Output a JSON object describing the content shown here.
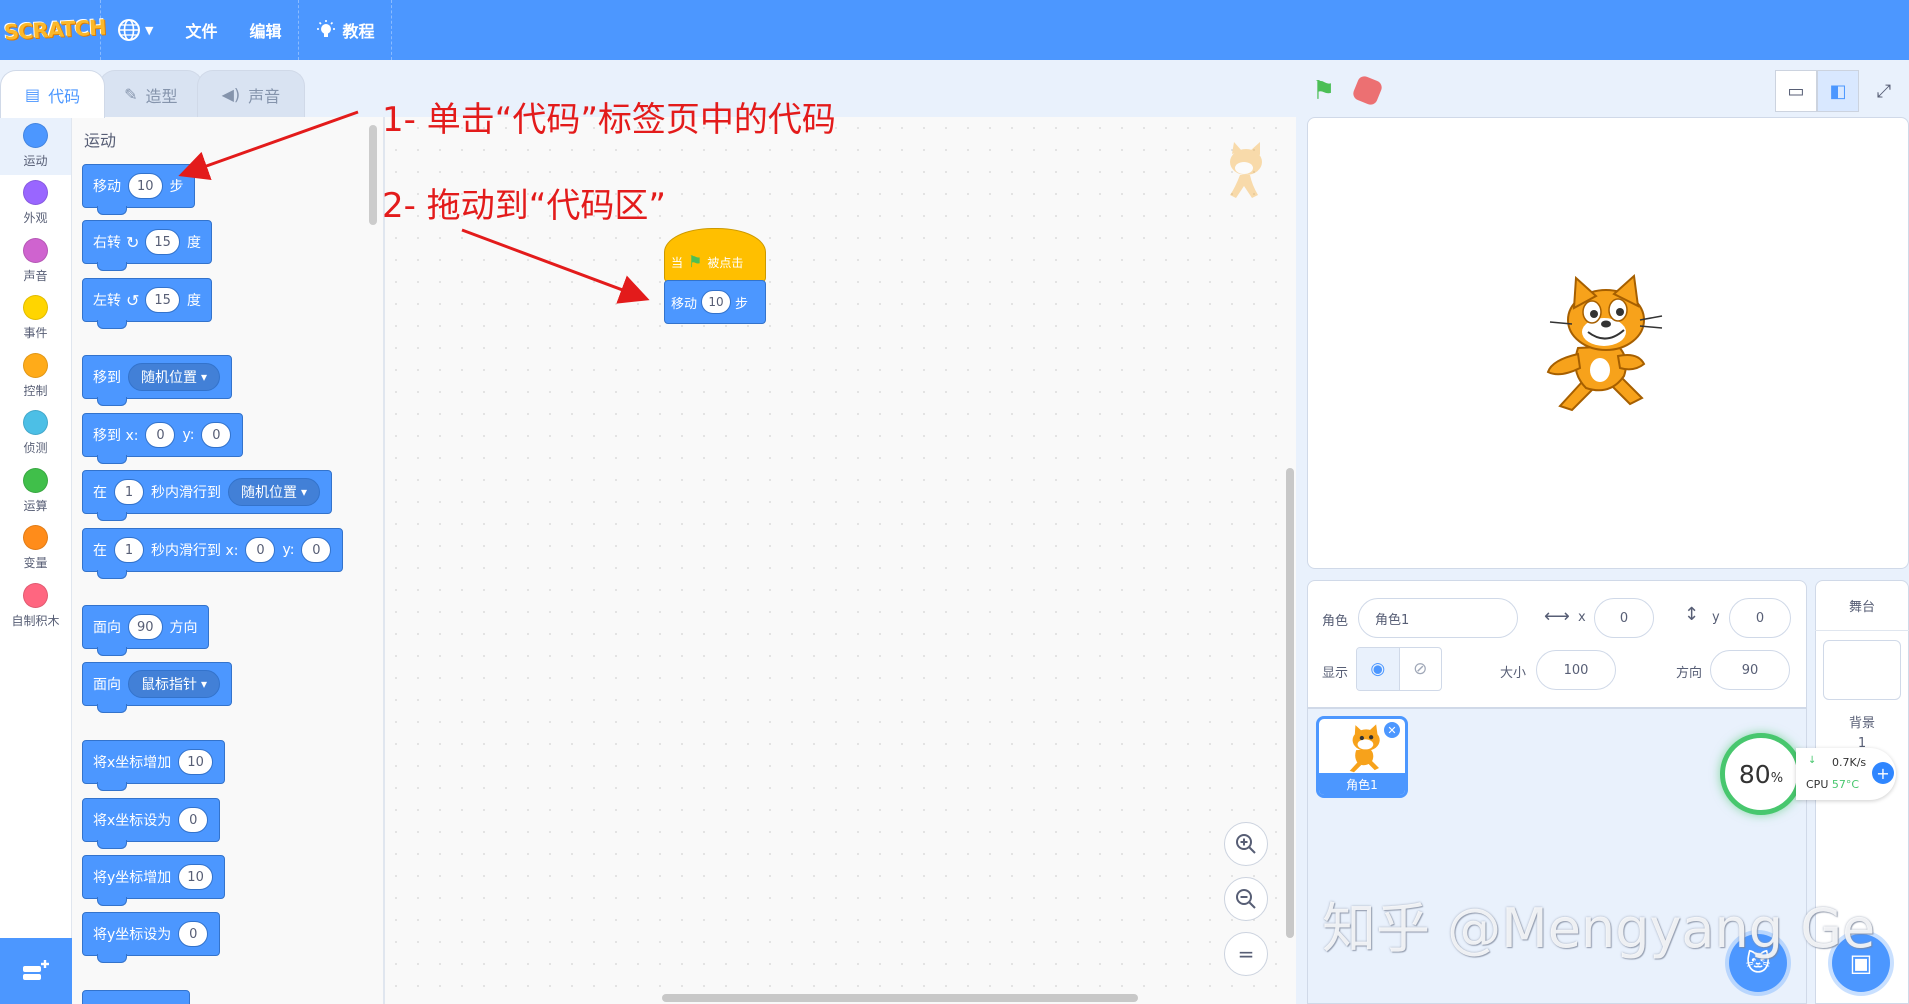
{
  "menu": {
    "logo": "SCRATCH",
    "language_icon": "globe-icon",
    "file": "文件",
    "edit": "编辑",
    "tutorials": "教程"
  },
  "tabs": [
    {
      "label": "代码",
      "icon": "code-icon",
      "active": true
    },
    {
      "label": "造型",
      "icon": "brush-icon",
      "active": false
    },
    {
      "label": "声音",
      "icon": "speaker-icon",
      "active": false
    }
  ],
  "categories": [
    {
      "label": "运动",
      "color": "#4c97ff"
    },
    {
      "label": "外观",
      "color": "#9966ff"
    },
    {
      "label": "声音",
      "color": "#cf63cf"
    },
    {
      "label": "事件",
      "color": "#ffd500"
    },
    {
      "label": "控制",
      "color": "#ffab19"
    },
    {
      "label": "侦测",
      "color": "#4cbfe6"
    },
    {
      "label": "运算",
      "color": "#40bf4a"
    },
    {
      "label": "变量",
      "color": "#ff8c1a"
    },
    {
      "label": "自制积木",
      "color": "#ff6680"
    }
  ],
  "palette": {
    "title": "运动",
    "blocks": {
      "move": {
        "label": "移动",
        "value": "10",
        "unit": "步"
      },
      "turn_right": {
        "label": "右转",
        "value": "15",
        "unit": "度"
      },
      "turn_left": {
        "label": "左转",
        "value": "15",
        "unit": "度"
      },
      "goto": {
        "label": "移到",
        "option": "随机位置"
      },
      "goto_xy": {
        "label": "移到 x:",
        "x": "0",
        "y_label": "y:",
        "y": "0"
      },
      "glide_to": {
        "label": "在",
        "secs": "1",
        "mid": "秒内滑行到",
        "option": "随机位置"
      },
      "glide_xy": {
        "label": "在",
        "secs": "1",
        "mid": "秒内滑行到 x:",
        "x": "0",
        "y_label": "y:",
        "y": "0"
      },
      "point_dir": {
        "label": "面向",
        "value": "90",
        "unit": "方向"
      },
      "point_towards": {
        "label": "面向",
        "option": "鼠标指针"
      },
      "change_x": {
        "label": "将x坐标增加",
        "value": "10"
      },
      "set_x": {
        "label": "将x坐标设为",
        "value": "0"
      },
      "change_y": {
        "label": "将y坐标增加",
        "value": "10"
      },
      "set_y": {
        "label": "将y坐标设为",
        "value": "0"
      }
    }
  },
  "code": {
    "hat": {
      "when": "当",
      "clicked": "被点击"
    },
    "move": {
      "label": "移动",
      "value": "10",
      "unit": "步"
    }
  },
  "annotations": {
    "step1": "1- 单击“代码”标签页中的代码",
    "step2": "2- 拖动到“代码区”"
  },
  "zoom": {
    "in": "+",
    "out": "−",
    "reset": "="
  },
  "sprite_info": {
    "sprite_label": "角色",
    "sprite_name": "角色1",
    "x_label": "x",
    "x": "0",
    "y_label": "y",
    "y": "0",
    "show_label": "显示",
    "size_label": "大小",
    "size": "100",
    "direction_label": "方向",
    "direction": "90"
  },
  "sprite_list": [
    {
      "name": "角色1",
      "selected": true
    }
  ],
  "stage_pane": {
    "title": "舞台",
    "backdrop_label": "背景",
    "backdrop_count": "1"
  },
  "perf_widget": {
    "percent": "80",
    "percent_sign": "%",
    "net_speed": "0.7K/s",
    "cpu_label": "CPU",
    "cpu_temp": "57°C"
  },
  "watermark": "知乎 @Mengyang Ge",
  "colors": {
    "motion": "#4c97ff",
    "events": "#ffbf00",
    "annotation": "#e31b1b",
    "menubar": "#4c97ff"
  }
}
